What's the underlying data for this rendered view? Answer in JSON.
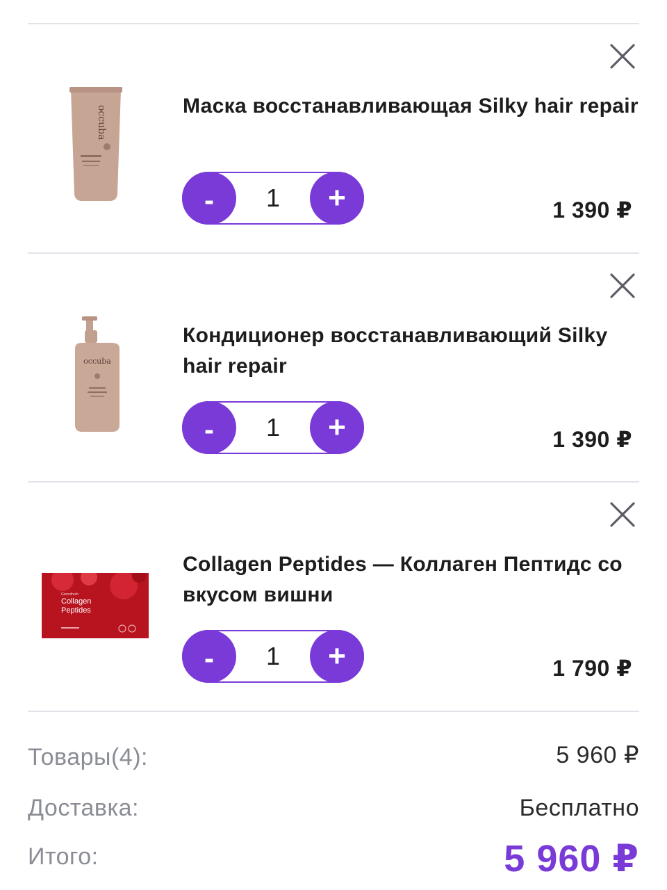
{
  "cart": {
    "items": [
      {
        "title": "Маска восстанавливающая Silky hair repair",
        "quantity": "1",
        "price": "1 390 ₽",
        "image": {
          "kind": "tube",
          "brand": "occuba",
          "color": "#c6a595"
        }
      },
      {
        "title": "Кондиционер восстанавливающий Silky hair repair",
        "quantity": "1",
        "price": "1 390 ₽",
        "image": {
          "kind": "pump-bottle",
          "brand": "occuba",
          "color": "#c9a898"
        }
      },
      {
        "title": "Collagen Peptides — Коллаген Пептидс со вкусом вишни",
        "quantity": "1",
        "price": "1 790 ₽",
        "image": {
          "kind": "box",
          "brand": "Greenfresh",
          "line1": "Collagen",
          "line2": "Peptides",
          "color": "#c0182a"
        }
      }
    ],
    "controls": {
      "minus": "-",
      "plus": "+",
      "close_icon": "close-icon"
    }
  },
  "summary": {
    "goods_label": "Товары(4):",
    "goods_value": "5 960 ₽",
    "delivery_label": "Доставка:",
    "delivery_value": "Бесплатно",
    "total_label": "Итого:",
    "total_value": "5 960 ₽"
  },
  "colors": {
    "accent": "#7a3ad8",
    "divider": "#e3e3ea",
    "muted": "#8b8d96"
  }
}
